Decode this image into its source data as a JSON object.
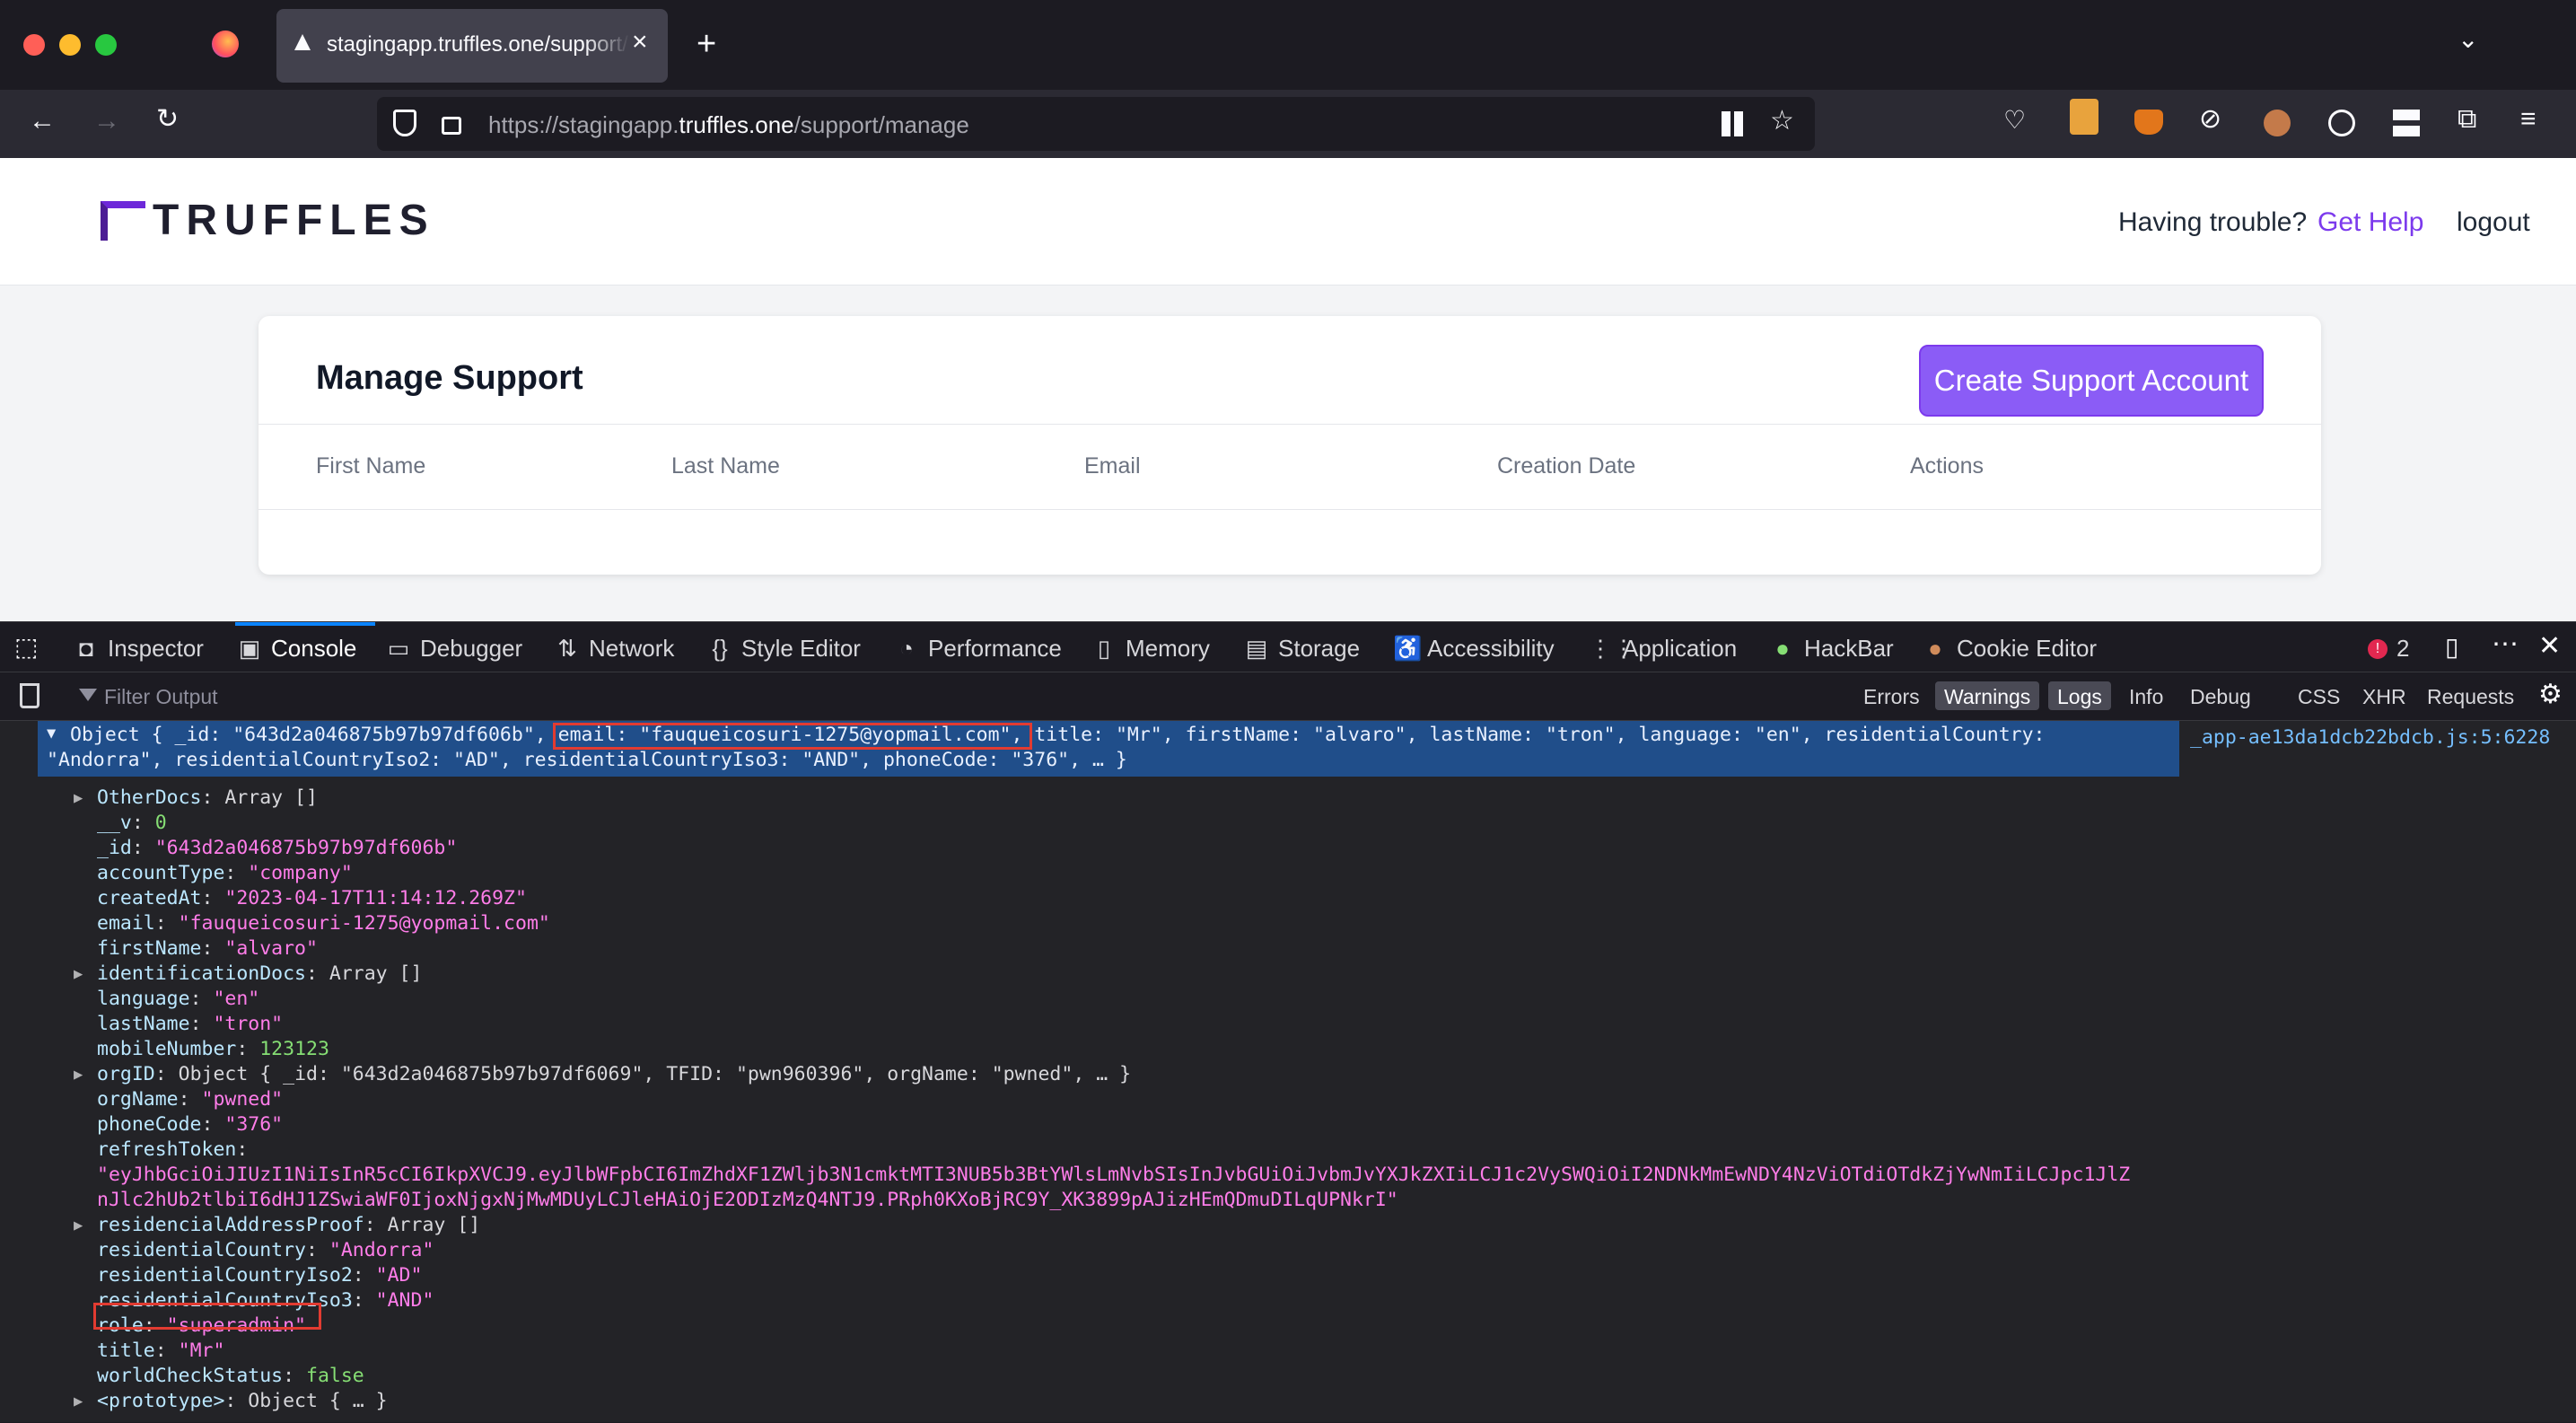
{
  "browser": {
    "tab_title": "stagingapp.truffles.one/support/manage",
    "url_prefix": "https://stagingapp.",
    "url_domain": "truffles.one",
    "url_path": "/support/manage",
    "colors": {
      "tab_bg": "#42414d",
      "chrome_bg": "#1c1b22",
      "traffic_red": "#ff5f57",
      "traffic_yellow": "#febc2e",
      "traffic_green": "#28c840"
    }
  },
  "site": {
    "logo": "TRUFFLES",
    "help_text": "Having trouble?",
    "help_link": "Get Help",
    "logout": "logout",
    "card_title": "Manage Support",
    "create_button": "Create Support Account",
    "columns": [
      "First Name",
      "Last Name",
      "Email",
      "Creation Date",
      "Actions"
    ],
    "colors": {
      "accent": "#8b5cf6",
      "link": "#7c3aed"
    }
  },
  "devtools": {
    "tabs": [
      "Inspector",
      "Console",
      "Debugger",
      "Network",
      "Style Editor",
      "Performance",
      "Memory",
      "Storage",
      "Accessibility",
      "Application",
      "HackBar",
      "Cookie Editor"
    ],
    "error_count": "2",
    "filter_placeholder": "Filter Output",
    "levels": [
      "Errors",
      "Warnings",
      "Logs",
      "Info",
      "Debug",
      "CSS",
      "XHR",
      "Requests"
    ],
    "source": "_app-ae13da1dcb22bdcb.js:5:6228",
    "object_preview_line1": "Object { _id: \"643d2a046875b97b97df606b\", email: \"fauqueicosuri-1275@yopmail.com\", title: \"Mr\", firstName: \"alvaro\", lastName: \"tron\", language: \"en\", residentialCountry:",
    "object_preview_line2": "\"Andorra\", residentialCountryIso2: \"AD\", residentialCountryIso3: \"AND\", phoneCode: \"376\", … }",
    "lines": [
      {
        "key": "OtherDocs",
        "val": "Array []",
        "type": "o",
        "expand": true
      },
      {
        "key": "__v",
        "val": "0",
        "type": "n"
      },
      {
        "key": "_id",
        "val": "\"643d2a046875b97b97df606b\"",
        "type": "s"
      },
      {
        "key": "accountType",
        "val": "\"company\"",
        "type": "s"
      },
      {
        "key": "createdAt",
        "val": "\"2023-04-17T11:14:12.269Z\"",
        "type": "s"
      },
      {
        "key": "email",
        "val": "\"fauqueicosuri-1275@yopmail.com\"",
        "type": "s"
      },
      {
        "key": "firstName",
        "val": "\"alvaro\"",
        "type": "s"
      },
      {
        "key": "identificationDocs",
        "val": "Array []",
        "type": "o",
        "expand": true
      },
      {
        "key": "language",
        "val": "\"en\"",
        "type": "s"
      },
      {
        "key": "lastName",
        "val": "\"tron\"",
        "type": "s"
      },
      {
        "key": "mobileNumber",
        "val": "123123",
        "type": "n"
      },
      {
        "key": "orgID",
        "val": "Object { _id: \"643d2a046875b97b97df6069\", TFID: \"pwn960396\", orgName: \"pwned\", … }",
        "type": "o",
        "expand": true
      },
      {
        "key": "orgName",
        "val": "\"pwned\"",
        "type": "s"
      },
      {
        "key": "phoneCode",
        "val": "\"376\"",
        "type": "s"
      },
      {
        "key": "refreshToken",
        "val": "",
        "type": "s"
      },
      {
        "key": "",
        "val": "\"eyJhbGciOiJIUzI1NiIsInR5cCI6IkpXVCJ9.eyJlbWFpbCI6ImZhdXF1ZWljb3N1cmktMTI3NUB5b3BtYWlsLmNvbSIsInJvbGUiOiJvbmJvYXJkZXIiLCJ1c2VySWQiOiI2NDNkMmEwNDY4NzViOTdiOTdkZjYwNmIiLCJpc1JlZ",
        "type": "s"
      },
      {
        "key": "",
        "val": "nJlc2hUb2tlbiI6dHJ1ZSwiaWF0IjoxNjgxNjMwMDUyLCJleHAiOjE2ODIzMzQ4NTJ9.PRph0KXoBjRC9Y_XK3899pAJizHEmQDmuDILqUPNkrI\"",
        "type": "s"
      },
      {
        "key": "residencialAddressProof",
        "val": "Array []",
        "type": "o",
        "expand": true
      },
      {
        "key": "residentialCountry",
        "val": "\"Andorra\"",
        "type": "s"
      },
      {
        "key": "residentialCountryIso2",
        "val": "\"AD\"",
        "type": "s"
      },
      {
        "key": "residentialCountryIso3",
        "val": "\"AND\"",
        "type": "s"
      },
      {
        "key": "role",
        "val": "\"superadmin\"",
        "type": "s"
      },
      {
        "key": "title",
        "val": "\"Mr\"",
        "type": "s"
      },
      {
        "key": "worldCheckStatus",
        "val": "false",
        "type": "n"
      },
      {
        "key": "<prototype>",
        "val": "Object { … }",
        "type": "o",
        "expand": true
      }
    ]
  }
}
